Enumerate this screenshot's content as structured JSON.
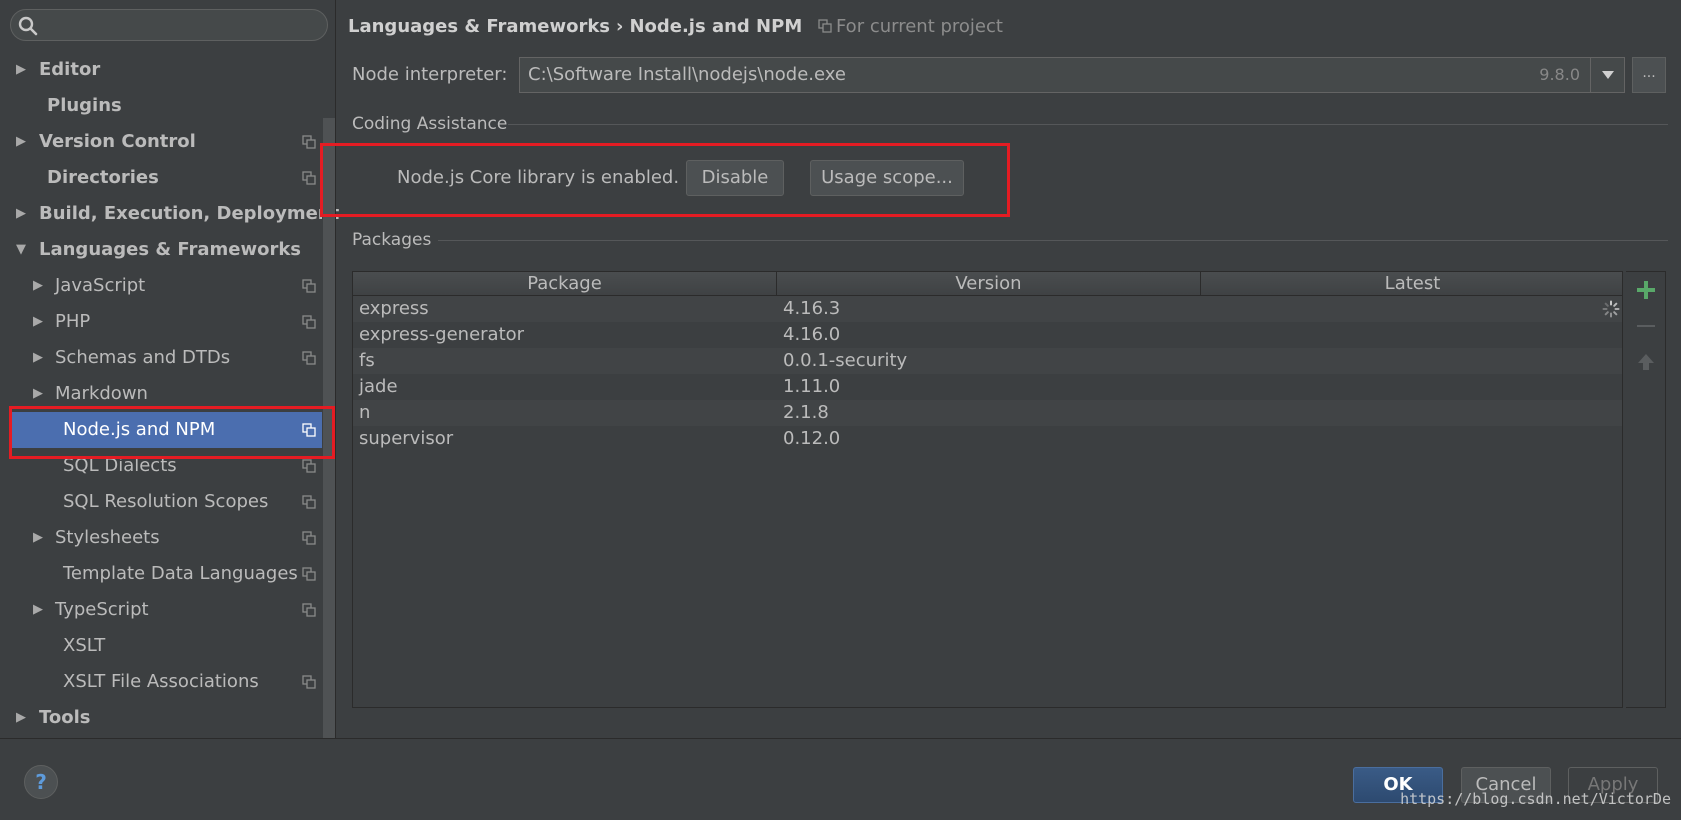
{
  "search": {
    "placeholder": "",
    "icon": "search-icon"
  },
  "sidebar": {
    "items": [
      {
        "label": "Editor",
        "arrow": "▶"
      },
      {
        "label": "Plugins",
        "arrow": ""
      },
      {
        "label": "Version Control",
        "arrow": "▶"
      },
      {
        "label": "Directories",
        "arrow": ""
      },
      {
        "label": "Build, Execution, Deployment",
        "arrow": "▶"
      },
      {
        "label": "Languages & Frameworks",
        "arrow": "▼"
      },
      {
        "label": "JavaScript",
        "arrow": "▶"
      },
      {
        "label": "PHP",
        "arrow": "▶"
      },
      {
        "label": "Schemas and DTDs",
        "arrow": "▶"
      },
      {
        "label": "Markdown",
        "arrow": "▶"
      },
      {
        "label": "Node.js and NPM",
        "arrow": ""
      },
      {
        "label": "SQL Dialects",
        "arrow": ""
      },
      {
        "label": "SQL Resolution Scopes",
        "arrow": ""
      },
      {
        "label": "Stylesheets",
        "arrow": "▶"
      },
      {
        "label": "Template Data Languages",
        "arrow": ""
      },
      {
        "label": "TypeScript",
        "arrow": "▶"
      },
      {
        "label": "XSLT",
        "arrow": ""
      },
      {
        "label": "XSLT File Associations",
        "arrow": ""
      },
      {
        "label": "Tools",
        "arrow": "▶"
      }
    ]
  },
  "breadcrumb": {
    "section": "Languages & Frameworks",
    "separator": "›",
    "page": "Node.js and NPM",
    "scope": "For current project"
  },
  "interpreter": {
    "label": "Node interpreter:",
    "path": "C:\\Software Install\\nodejs\\node.exe",
    "version": "9.8.0",
    "browse": "..."
  },
  "coding_assistance": {
    "title": "Coding Assistance",
    "status": "Node.js Core library is enabled.",
    "disable_label": "Disable",
    "scope_label": "Usage scope..."
  },
  "packages": {
    "title": "Packages",
    "columns": [
      "Package",
      "Version",
      "Latest"
    ],
    "rows": [
      {
        "name": "express",
        "version": "4.16.3",
        "latest": ""
      },
      {
        "name": "express-generator",
        "version": "4.16.0",
        "latest": ""
      },
      {
        "name": "fs",
        "version": "0.0.1-security",
        "latest": ""
      },
      {
        "name": "jade",
        "version": "1.11.0",
        "latest": ""
      },
      {
        "name": "n",
        "version": "2.1.8",
        "latest": ""
      },
      {
        "name": "supervisor",
        "version": "0.12.0",
        "latest": ""
      }
    ]
  },
  "footer": {
    "help": "?",
    "ok": "OK",
    "cancel": "Cancel",
    "apply": "Apply",
    "watermark": "https://blog.csdn.net/VictorDe"
  },
  "colors": {
    "background": "#3c3f41",
    "selection": "#4b6eaf",
    "highlight": "#e51c23",
    "add": "#59a869"
  }
}
